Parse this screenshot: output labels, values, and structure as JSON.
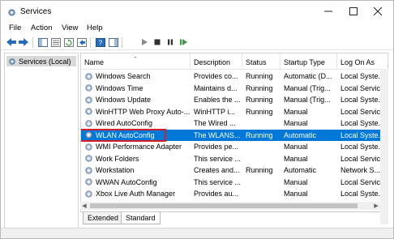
{
  "window": {
    "title": "Services",
    "icon": "services-gear-icon"
  },
  "menu": {
    "file": "File",
    "action": "Action",
    "view": "View",
    "help": "Help"
  },
  "tree": {
    "root_label": "Services (Local)"
  },
  "columns": {
    "name": "Name",
    "description": "Description",
    "status": "Status",
    "startup_type": "Startup Type",
    "log_on_as": "Log On As"
  },
  "services": [
    {
      "name": "Windows Search",
      "description": "Provides co...",
      "status": "Running",
      "startup": "Automatic (D...",
      "logon": "Local Syste..."
    },
    {
      "name": "Windows Time",
      "description": "Maintains d...",
      "status": "Running",
      "startup": "Manual (Trig...",
      "logon": "Local Service"
    },
    {
      "name": "Windows Update",
      "description": "Enables the ...",
      "status": "Running",
      "startup": "Manual (Trig...",
      "logon": "Local Syste..."
    },
    {
      "name": "WinHTTP Web Proxy Auto-...",
      "description": "WinHTTP i...",
      "status": "Running",
      "startup": "Manual",
      "logon": "Local Service"
    },
    {
      "name": "Wired AutoConfig",
      "description": "The Wired ...",
      "status": "",
      "startup": "Manual",
      "logon": "Local Syste..."
    },
    {
      "name": "WLAN AutoConfig",
      "description": "The WLANS...",
      "status": "Running",
      "startup": "Automatic",
      "logon": "Local Syste...",
      "selected": true
    },
    {
      "name": "WMI Performance Adapter",
      "description": "Provides pe...",
      "status": "",
      "startup": "Manual",
      "logon": "Local Syste..."
    },
    {
      "name": "Work Folders",
      "description": "This service ...",
      "status": "",
      "startup": "Manual",
      "logon": "Local Service"
    },
    {
      "name": "Workstation",
      "description": "Creates and...",
      "status": "Running",
      "startup": "Automatic",
      "logon": "Network S..."
    },
    {
      "name": "WWAN AutoConfig",
      "description": "This service ...",
      "status": "",
      "startup": "Manual",
      "logon": "Local Service"
    },
    {
      "name": "Xbox Live Auth Manager",
      "description": "Provides au...",
      "status": "",
      "startup": "Manual",
      "logon": "Local Syste..."
    }
  ],
  "tabs": {
    "extended": "Extended",
    "standard": "Standard"
  },
  "colors": {
    "selection": "#0078d7",
    "highlight_box": "#d11f2c"
  }
}
